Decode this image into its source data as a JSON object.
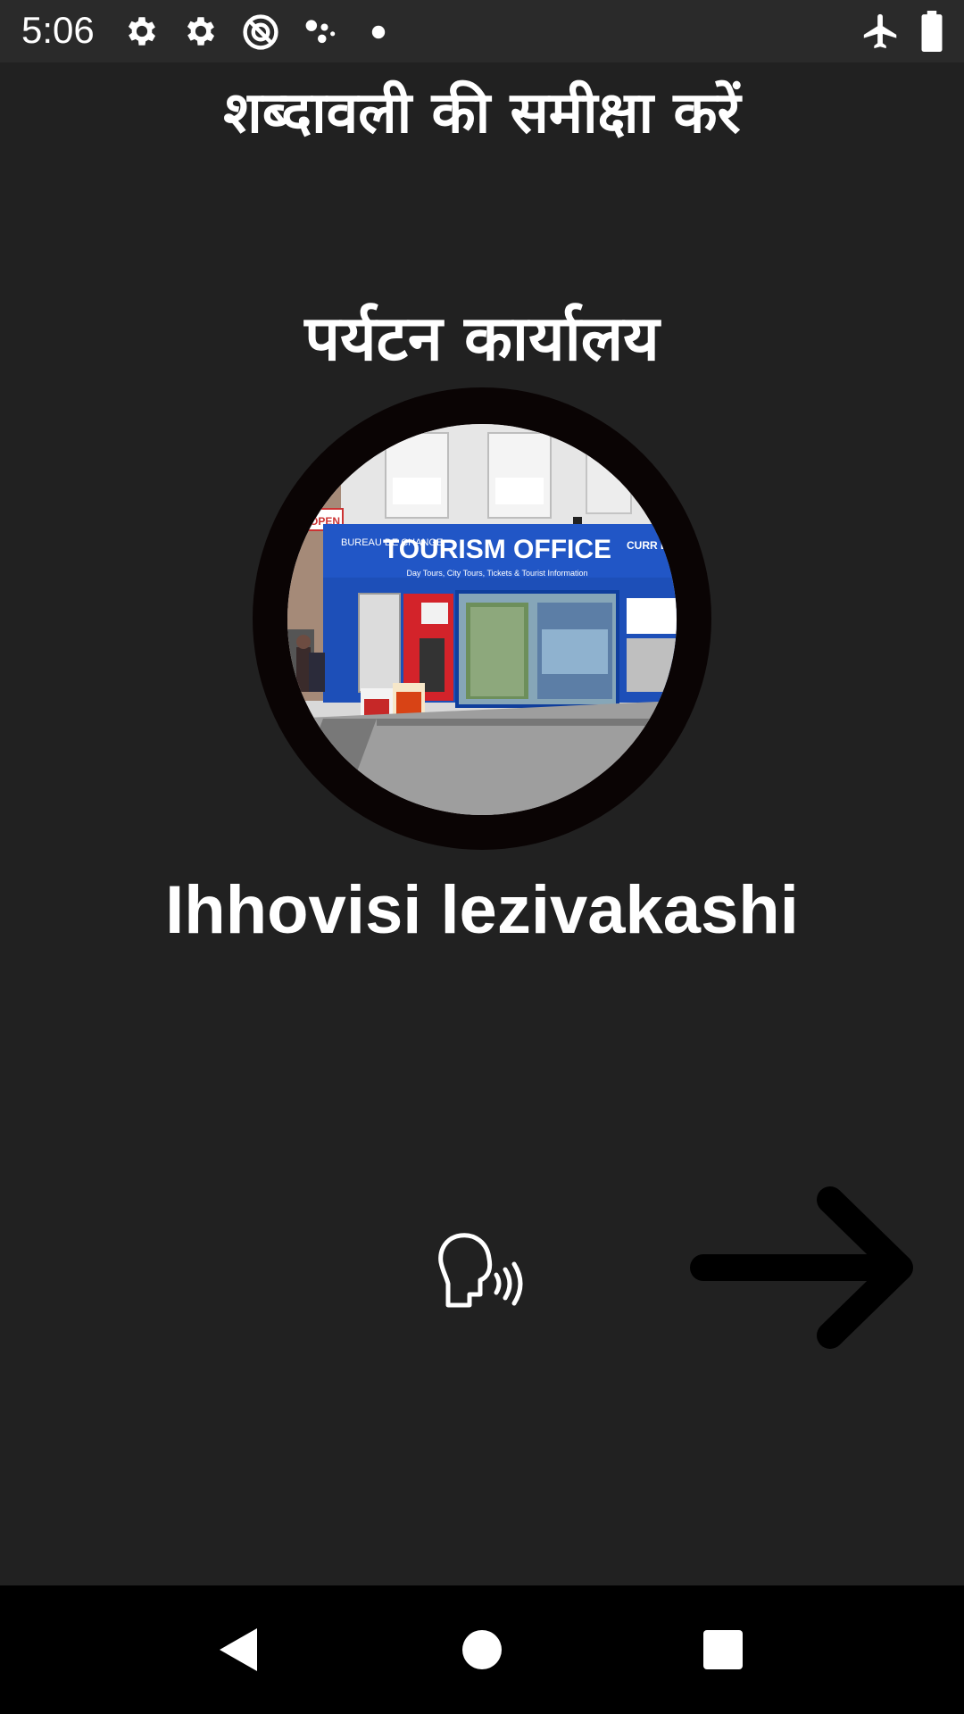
{
  "status_bar": {
    "time": "5:06",
    "icons": [
      "gear-icon",
      "gear-icon",
      "no-sync-icon",
      "assistant-dots-icon",
      "dot-icon",
      "airplane-mode-icon",
      "battery-icon"
    ]
  },
  "review": {
    "title": "शब्दावली की समीक्षा करें",
    "word_native": "पर्यटन कार्यालय",
    "word_translation": "Ihhovisi lezivakashi",
    "image_signs": {
      "main_sign": "TOURISM OFFICE",
      "sub_sign": "Day Tours, City Tours, Tickets & Tourist Information",
      "left_sign": "BUREAU DE CHANGE",
      "right_sign": "CURR EXCHA",
      "open_sign": "OPEN"
    }
  },
  "actions": {
    "speak_icon": "speak-icon",
    "next_icon": "arrow-right-icon"
  },
  "nav": {
    "back_icon": "back-triangle-icon",
    "home_icon": "home-circle-icon",
    "recents_icon": "recents-square-icon"
  },
  "colors": {
    "background": "#212121",
    "status_bar": "#2a2a2a",
    "nav_bar": "#000000",
    "text": "#ffffff",
    "office_blue": "#1d4fb8"
  }
}
